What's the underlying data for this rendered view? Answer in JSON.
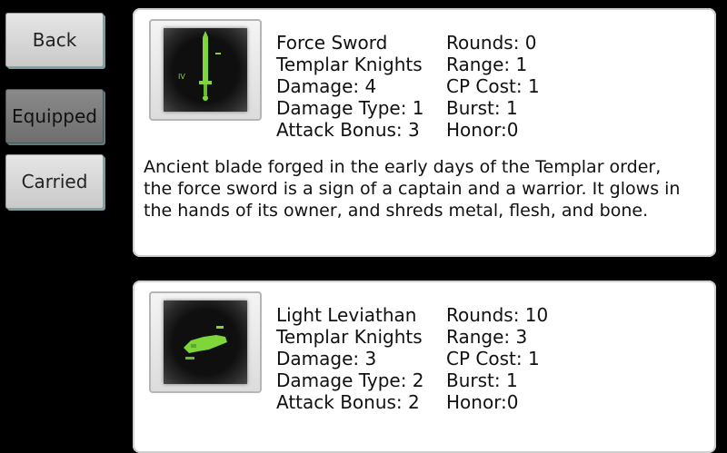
{
  "sidebar": {
    "back_label": "Back",
    "equipped_label": "Equipped",
    "carried_label": "Carried"
  },
  "items": [
    {
      "name": "Force Sword",
      "faction": "Templar Knights",
      "damage": "Damage: 4",
      "damage_type": "Damage Type: 1",
      "attack_bonus": "Attack Bonus: 3",
      "rounds": "Rounds: 0",
      "range": "Range: 1",
      "cp_cost": "CP Cost: 1",
      "burst": "Burst: 1",
      "honor": "Honor:0",
      "description": "Ancient blade forged in the early days of the Templar order, the force sword is a sign of a captain and a warrior. It glows in the hands of its owner, and shreds metal, flesh, and bone.",
      "icon": "sword-icon"
    },
    {
      "name": "Light Leviathan",
      "faction": "Templar Knights",
      "damage": "Damage: 3",
      "damage_type": "Damage Type: 2",
      "attack_bonus": "Attack Bonus: 2",
      "rounds": "Rounds: 10",
      "range": "Range: 3",
      "cp_cost": "CP Cost: 1",
      "burst": "Burst: 1",
      "honor": "Honor:0",
      "description": "",
      "icon": "leviathan-icon"
    }
  ],
  "colors": {
    "icon_green": "#7fd63a",
    "card_bg": "#ffffff",
    "page_bg": "#000000"
  }
}
